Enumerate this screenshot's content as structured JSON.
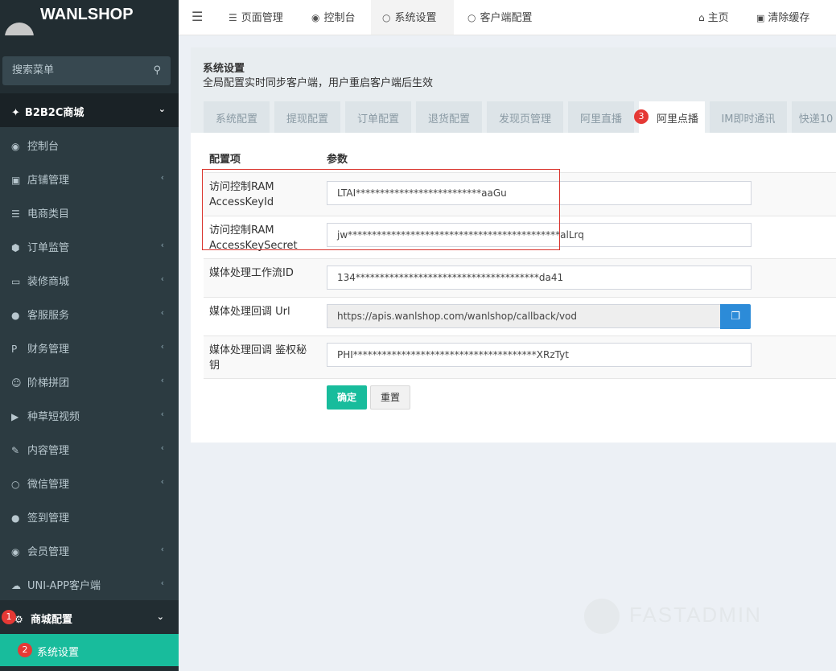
{
  "app": {
    "logo_text": "WANLSHOP"
  },
  "sidebar": {
    "search_placeholder": "搜索菜单",
    "group_title": "B2B2C商城",
    "items": [
      {
        "label": "控制台",
        "icon": "dashboard-icon",
        "has_arrow": false
      },
      {
        "label": "店铺管理",
        "icon": "store-icon",
        "has_arrow": true
      },
      {
        "label": "电商类目",
        "icon": "list-icon",
        "has_arrow": false
      },
      {
        "label": "订单监管",
        "icon": "cube-icon",
        "has_arrow": true
      },
      {
        "label": "装修商城",
        "icon": "desktop-icon",
        "has_arrow": true
      },
      {
        "label": "客服服务",
        "icon": "comments-icon",
        "has_arrow": true
      },
      {
        "label": "财务管理",
        "icon": "paypal-icon",
        "has_arrow": true
      },
      {
        "label": "阶梯拼团",
        "icon": "users-icon",
        "has_arrow": true
      },
      {
        "label": "种草短视频",
        "icon": "video-icon",
        "has_arrow": true
      },
      {
        "label": "内容管理",
        "icon": "edit-icon",
        "has_arrow": true
      },
      {
        "label": "微信管理",
        "icon": "wechat-icon",
        "has_arrow": true
      },
      {
        "label": "签到管理",
        "icon": "map-marker-icon",
        "has_arrow": false
      },
      {
        "label": "会员管理",
        "icon": "user-circle-icon",
        "has_arrow": true
      },
      {
        "label": "UNI-APP客户端",
        "icon": "cloud-icon",
        "has_arrow": true
      },
      {
        "label": "商城配置",
        "icon": "gear-icon",
        "has_arrow": true,
        "open": true,
        "badge": "1"
      }
    ],
    "active_sub": {
      "label": "系统设置",
      "badge": "2"
    }
  },
  "topnav": {
    "tabs": [
      {
        "label": "页面管理",
        "icon": "list-icon"
      },
      {
        "label": "控制台",
        "icon": "dashboard-icon"
      },
      {
        "label": "系统设置",
        "icon": "circle-icon",
        "active": true
      },
      {
        "label": "客户端配置",
        "icon": "circle-icon"
      }
    ],
    "home_label": "主页",
    "clear_cache_label": "清除缓存"
  },
  "panel": {
    "title": "系统设置",
    "subtitle": "全局配置实时同步客户端，用户重启客户端后生效",
    "tabs": [
      "系统配置",
      "提现配置",
      "订单配置",
      "退货配置",
      "发现页管理",
      "阿里直播",
      "阿里点播",
      "IM即时通讯",
      "快递10"
    ],
    "active_tab_badge": "3",
    "col_key": "配置项",
    "col_value": "参数",
    "rows": [
      {
        "label": "访问控制RAM AccessKeyId",
        "value": "LTAI**************************aaGu"
      },
      {
        "label": "访问控制RAM AccessKeySecret",
        "value": "jw********************************************alLrq"
      },
      {
        "label": "媒体处理工作流ID",
        "value": "134**************************************da41"
      },
      {
        "label": "媒体处理回调 Url",
        "value": "https://apis.wanlshop.com/wanlshop/callback/vod"
      },
      {
        "label": "媒体处理回调 鉴权秘钥",
        "value": "PHI**************************************XRzTyt"
      }
    ],
    "submit_label": "确定",
    "reset_label": "重置"
  },
  "watermark": "FASTADMIN",
  "colors": {
    "sidebar_bg": "#222d32",
    "accent_green": "#18bc9c",
    "copy_blue": "#2c8bd8",
    "badge_red": "#e53935",
    "highlight_red": "#d9332c"
  }
}
